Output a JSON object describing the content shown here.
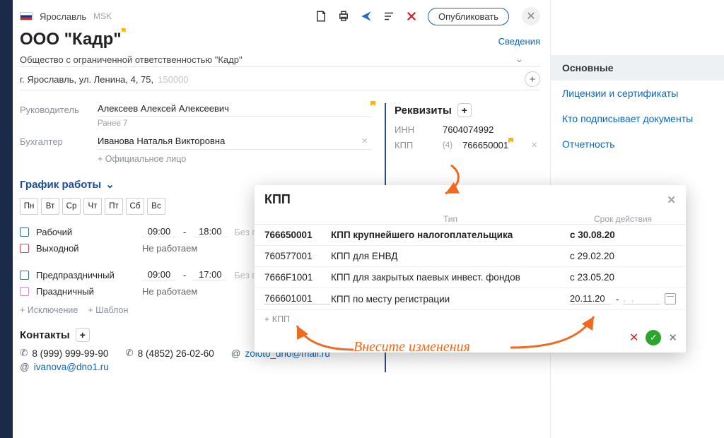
{
  "header": {
    "city": "Ярославль",
    "tz": "MSK",
    "publish": "Опубликовать"
  },
  "company": {
    "title": "ООО \"Кадр\"",
    "info_link": "Сведения",
    "full_name": "Общество с ограниченной ответственностью \"Кадр\"",
    "address": "г. Ярославль, ул. Ленина, 4, 75,",
    "zip": "150000"
  },
  "people": {
    "head_label": "Руководитель",
    "head_name": "Алексеев Алексей Алексеевич",
    "prev_hint": "Ранее 7",
    "accountant_label": "Бухгалтер",
    "accountant_name": "Иванова Наталья Викторовна",
    "add_official": "Официальное лицо"
  },
  "requisites": {
    "title": "Реквизиты",
    "inn_label": "ИНН",
    "inn": "7604074992",
    "kpp_label": "КПП",
    "kpp_count": "(4)",
    "kpp_main": "766650001"
  },
  "schedule": {
    "title": "График работы",
    "days": [
      "Пн",
      "Вт",
      "Ср",
      "Чт",
      "Пт",
      "Сб",
      "Вс"
    ],
    "rows": [
      {
        "label": "Рабочий",
        "from": "09:00",
        "to": "18:00",
        "note": "Без пер",
        "kind": "blue"
      },
      {
        "label": "Выходной",
        "text": "Не работаем",
        "kind": "red"
      },
      {
        "label": "Предпраздничный",
        "from": "09:00",
        "to": "17:00",
        "note": "Без пер",
        "kind": "blue"
      },
      {
        "label": "Праздничный",
        "text": "Не работаем",
        "kind": "pink"
      }
    ],
    "add_exception": "Исключение",
    "add_template": "Шаблон"
  },
  "contacts": {
    "title": "Контакты",
    "items": [
      {
        "icon": "phone",
        "text": "8 (999) 999-99-90"
      },
      {
        "icon": "phone",
        "text": "8 (4852) 26-02-60"
      },
      {
        "icon": "at",
        "text": "zoloto_dno@mail.ru",
        "link": true
      },
      {
        "icon": "at",
        "text": "ivanova@dno1.ru",
        "link": true
      }
    ]
  },
  "rightnav": [
    {
      "label": "Основные",
      "active": true
    },
    {
      "label": "Лицензии и сертификаты"
    },
    {
      "label": "Кто подписывает документы"
    },
    {
      "label": "Отчетность"
    }
  ],
  "popup": {
    "title": "КПП",
    "col_type": "Тип",
    "col_term": "Срок действия",
    "rows": [
      {
        "code": "766650001",
        "type": "КПП крупнейшего налогоплательщика",
        "term": "с 30.08.20",
        "bold": true
      },
      {
        "code": "760577001",
        "type": "КПП для ЕНВД",
        "term": "с 29.02.20"
      },
      {
        "code": "7666F1001",
        "type": "КПП для закрытых паевых инвест. фондов",
        "term": "с 23.05.20"
      }
    ],
    "edit": {
      "code": "766601001",
      "type": "КПП по месту регистрации",
      "date_from": "20.11.20",
      "date_to": "  .   .  "
    },
    "add_label": "КПП"
  },
  "annotation": {
    "text": "Внесите изменения"
  }
}
